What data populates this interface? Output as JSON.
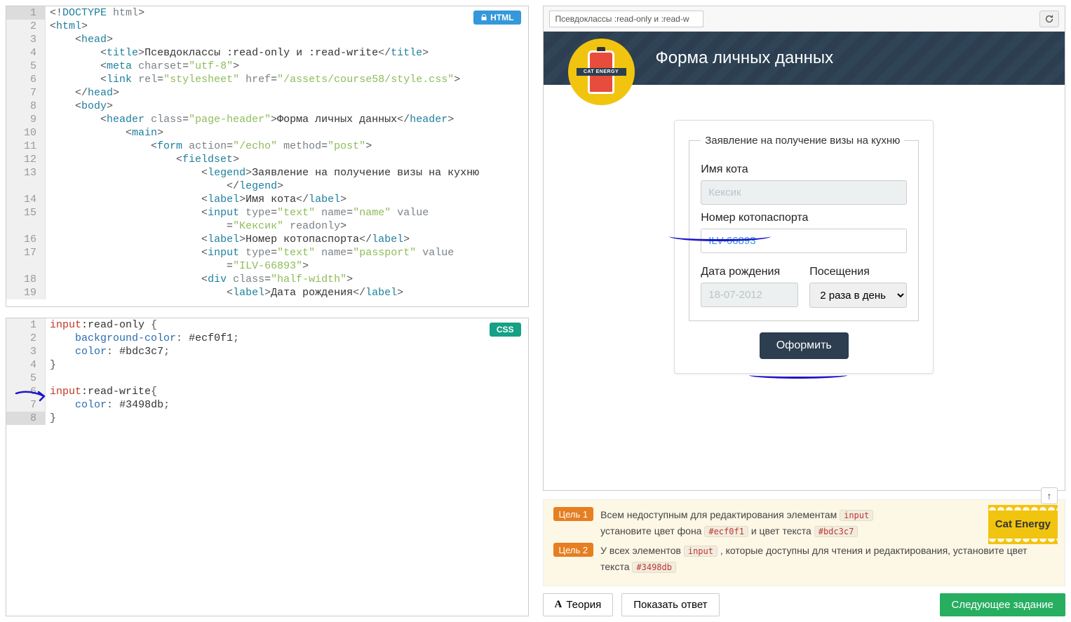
{
  "editors": {
    "html_badge": "HTML",
    "css_badge": "CSS",
    "html_lines": [
      {
        "n": "1",
        "html": "<span class='t-punc'>&lt;!</span><span class='t-tag'>DOCTYPE</span> <span class='t-attr'>html</span><span class='t-punc'>&gt;</span>",
        "active": true
      },
      {
        "n": "2",
        "html": "<span class='t-punc'>&lt;</span><span class='t-tag'>html</span><span class='t-punc'>&gt;</span>"
      },
      {
        "n": "3",
        "html": "    <span class='t-punc'>&lt;</span><span class='t-tag'>head</span><span class='t-punc'>&gt;</span>"
      },
      {
        "n": "4",
        "html": "        <span class='t-punc'>&lt;</span><span class='t-tag'>title</span><span class='t-punc'>&gt;</span><span class='t-text'>Псевдоклассы :read-only и :read-write</span><span class='t-punc'>&lt;/</span><span class='t-tag'>title</span><span class='t-punc'>&gt;</span>"
      },
      {
        "n": "5",
        "html": "        <span class='t-punc'>&lt;</span><span class='t-tag'>meta</span> <span class='t-attr'>charset</span><span class='t-punc'>=</span><span class='t-str'>\"utf-8\"</span><span class='t-punc'>&gt;</span>"
      },
      {
        "n": "6",
        "html": "        <span class='t-punc'>&lt;</span><span class='t-tag'>link</span> <span class='t-attr'>rel</span><span class='t-punc'>=</span><span class='t-str'>\"stylesheet\"</span> <span class='t-attr'>href</span><span class='t-punc'>=</span><span class='t-str'>\"/assets/course58/style.css\"</span><span class='t-punc'>&gt;</span>"
      },
      {
        "n": "7",
        "html": "    <span class='t-punc'>&lt;/</span><span class='t-tag'>head</span><span class='t-punc'>&gt;</span>"
      },
      {
        "n": "8",
        "html": "    <span class='t-punc'>&lt;</span><span class='t-tag'>body</span><span class='t-punc'>&gt;</span>"
      },
      {
        "n": "9",
        "html": "        <span class='t-punc'>&lt;</span><span class='t-tag'>header</span> <span class='t-attr'>class</span><span class='t-punc'>=</span><span class='t-str'>\"page-header\"</span><span class='t-punc'>&gt;</span><span class='t-text'>Форма личных данных</span><span class='t-punc'>&lt;/</span><span class='t-tag'>header</span><span class='t-punc'>&gt;</span>"
      },
      {
        "n": "10",
        "html": "            <span class='t-punc'>&lt;</span><span class='t-tag'>main</span><span class='t-punc'>&gt;</span>"
      },
      {
        "n": "11",
        "html": "                <span class='t-punc'>&lt;</span><span class='t-tag'>form</span> <span class='t-attr'>action</span><span class='t-punc'>=</span><span class='t-str'>\"/echo\"</span> <span class='t-attr'>method</span><span class='t-punc'>=</span><span class='t-str'>\"post\"</span><span class='t-punc'>&gt;</span>"
      },
      {
        "n": "12",
        "html": "                    <span class='t-punc'>&lt;</span><span class='t-tag'>fieldset</span><span class='t-punc'>&gt;</span>"
      },
      {
        "n": "13",
        "html": "                        <span class='t-punc'>&lt;</span><span class='t-tag'>legend</span><span class='t-punc'>&gt;</span><span class='t-text'>Заявление на получение визы на кухню</span>\n                            <span class='t-punc'>&lt;/</span><span class='t-tag'>legend</span><span class='t-punc'>&gt;</span>"
      },
      {
        "n": "14",
        "html": "                        <span class='t-punc'>&lt;</span><span class='t-tag'>label</span><span class='t-punc'>&gt;</span><span class='t-text'>Имя кота</span><span class='t-punc'>&lt;/</span><span class='t-tag'>label</span><span class='t-punc'>&gt;</span>"
      },
      {
        "n": "15",
        "html": "                        <span class='t-punc'>&lt;</span><span class='t-tag'>input</span> <span class='t-attr'>type</span><span class='t-punc'>=</span><span class='t-str'>\"text\"</span> <span class='t-attr'>name</span><span class='t-punc'>=</span><span class='t-str'>\"name\"</span> <span class='t-attr'>value</span>\n                            <span class='t-punc'>=</span><span class='t-str'>\"Кексик\"</span> <span class='t-attr'>readonly</span><span class='t-punc'>&gt;</span>"
      },
      {
        "n": "16",
        "html": "                        <span class='t-punc'>&lt;</span><span class='t-tag'>label</span><span class='t-punc'>&gt;</span><span class='t-text'>Номер котопаспорта</span><span class='t-punc'>&lt;/</span><span class='t-tag'>label</span><span class='t-punc'>&gt;</span>"
      },
      {
        "n": "17",
        "html": "                        <span class='t-punc'>&lt;</span><span class='t-tag'>input</span> <span class='t-attr'>type</span><span class='t-punc'>=</span><span class='t-str'>\"text\"</span> <span class='t-attr'>name</span><span class='t-punc'>=</span><span class='t-str'>\"passport\"</span> <span class='t-attr'>value</span>\n                            <span class='t-punc'>=</span><span class='t-str'>\"ILV-66893\"</span><span class='t-punc'>&gt;</span>"
      },
      {
        "n": "18",
        "html": "                        <span class='t-punc'>&lt;</span><span class='t-tag'>div</span> <span class='t-attr'>class</span><span class='t-punc'>=</span><span class='t-str'>\"half-width\"</span><span class='t-punc'>&gt;</span>"
      },
      {
        "n": "19",
        "html": "                            <span class='t-punc'>&lt;</span><span class='t-tag'>label</span><span class='t-punc'>&gt;</span><span class='t-text'>Дата рождения</span><span class='t-punc'>&lt;/</span><span class='t-tag'>label</span><span class='t-punc'>&gt;</span>"
      }
    ],
    "css_lines": [
      {
        "n": "1",
        "html": "<span class='c-sel'>input</span><span class='c-pseudo'>:read-only</span> <span class='t-punc'>{</span>"
      },
      {
        "n": "2",
        "html": "    <span class='c-prop'>background-color</span><span class='t-punc'>:</span> <span class='c-val'>#ecf0f1</span><span class='t-punc'>;</span>"
      },
      {
        "n": "3",
        "html": "    <span class='c-prop'>color</span><span class='t-punc'>:</span> <span class='c-val'>#bdc3c7</span><span class='t-punc'>;</span>"
      },
      {
        "n": "4",
        "html": "<span class='t-punc'>}</span>"
      },
      {
        "n": "5",
        "html": " "
      },
      {
        "n": "6",
        "html": "<span class='c-sel'>input</span><span class='c-pseudo'>:read-write</span><span class='t-punc'>{</span>"
      },
      {
        "n": "7",
        "html": "    <span class='c-prop'>color</span><span class='t-punc'>:</span> <span class='c-val'>#3498db</span><span class='t-punc'>;</span>"
      },
      {
        "n": "8",
        "html": "<span class='t-punc'>}</span>",
        "active": true
      }
    ]
  },
  "preview": {
    "address": "Псевдоклассы :read-only и :read-w",
    "header": "Форма личных данных",
    "logo_text": "CAT ENERGY",
    "legend": "Заявление на получение визы на кухню",
    "labels": {
      "name": "Имя кота",
      "passport": "Номер котопаспорта",
      "dob": "Дата рождения",
      "visits": "Посещения"
    },
    "values": {
      "name": "Кексик",
      "passport": "ILV-66893",
      "dob": "18-07-2012",
      "visits": "2 раза в день"
    },
    "submit": "Оформить"
  },
  "goals": {
    "g1_badge": "Цель 1",
    "g1_text_a": "Всем недоступным для редактирования элементам ",
    "g1_chip1": "input",
    "g1_text_b": " установите цвет фона ",
    "g1_chip2": "#ecf0f1",
    "g1_text_c": " и цвет текста ",
    "g1_chip3": "#bdc3c7",
    "g2_badge": "Цель 2",
    "g2_text_a": "У всех элементов ",
    "g2_chip1": "input",
    "g2_text_b": " , которые доступны для чтения и редактирования, установите цвет текста ",
    "g2_chip2": "#3498db",
    "stamp": "Cat Energy"
  },
  "footer": {
    "theory": "Теория",
    "show": "Показать ответ",
    "next": "Следующее задание"
  }
}
